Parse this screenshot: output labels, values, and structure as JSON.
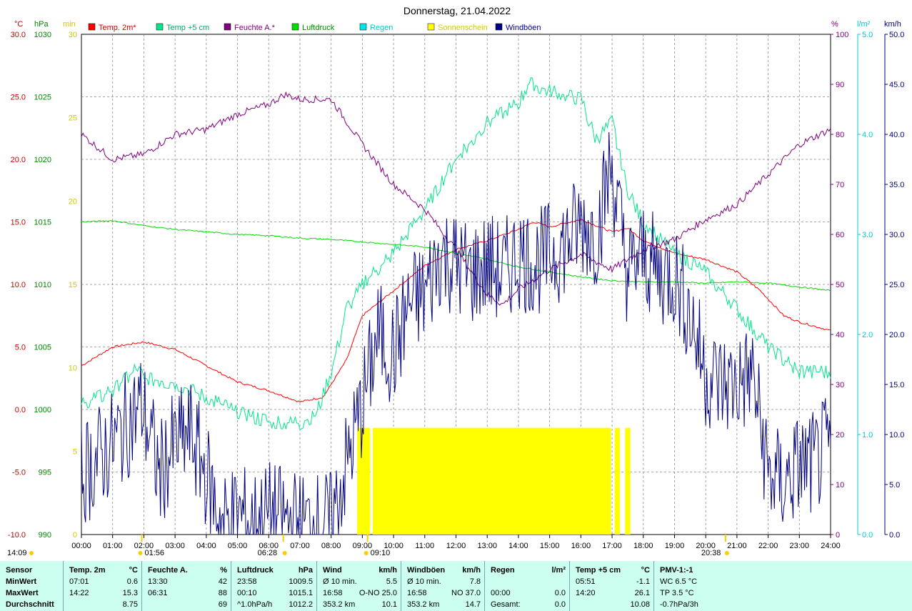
{
  "title": "Donnerstag, 21.04.2022",
  "colors": {
    "temp_2m": "#ff0000",
    "temp_5cm": "#00e68a",
    "feuchte": "#800080",
    "luftdruck": "#00dd00",
    "regen": "#00e5e5",
    "sonne": "#ffff00",
    "windboen": "#000080"
  },
  "axes": {
    "temp": {
      "unit": "°C",
      "ticks": [
        "30.0",
        "25.0",
        "20.0",
        "15.0",
        "10.0",
        "5.0",
        "0.0",
        "-5.0",
        "-10.0"
      ]
    },
    "pressure": {
      "unit": "hPa",
      "ticks": [
        "1030",
        "1025",
        "1020",
        "1015",
        "1010",
        "1005",
        "1000",
        "995",
        "990"
      ]
    },
    "minutes": {
      "unit": "min",
      "ticks": [
        "30",
        "25",
        "20",
        "15",
        "10",
        "5",
        "0"
      ]
    },
    "humidity": {
      "unit": "%",
      "ticks": [
        "100",
        "90",
        "80",
        "70",
        "60",
        "50",
        "40",
        "30",
        "20",
        "10",
        "0"
      ]
    },
    "rain": {
      "unit": "l/m²",
      "ticks": [
        "5.0",
        "4.0",
        "3.0",
        "2.0",
        "1.0",
        "0.0"
      ]
    },
    "wind": {
      "unit": "km/h",
      "ticks": [
        "50.0",
        "45.0",
        "40.0",
        "35.0",
        "30.0",
        "25.0",
        "20.0",
        "15.0",
        "10.0",
        "5.0",
        "0.0"
      ]
    },
    "x_ticks": [
      "00:00",
      "01:00",
      "02:00",
      "03:00",
      "04:00",
      "05:00",
      "06:00",
      "07:00",
      "08:00",
      "09:00",
      "10:00",
      "11:00",
      "12:00",
      "13:00",
      "14:00",
      "15:00",
      "16:00",
      "17:00",
      "18:00",
      "19:00",
      "20:00",
      "21:00",
      "22:00",
      "23:00",
      "24:00"
    ]
  },
  "legend": [
    "Temp. 2m*",
    "Temp +5 cm",
    "Feuchte A.*",
    "Luftdruck",
    "Regen",
    "Sonnenschein",
    "Windböen"
  ],
  "markers": {
    "moonrise": "14:09",
    "moonset": "01:56",
    "sunrise": "06:28",
    "sunrise_sun": "09:10",
    "sunset": "20:38"
  },
  "chart_data": {
    "type": "line",
    "x_range": [
      "00:00",
      "24:00"
    ],
    "series": [
      {
        "name": "Temp. 2m*",
        "unit": "°C",
        "points": [
          [
            "00:00",
            3.5
          ],
          [
            "01:00",
            5.0
          ],
          [
            "02:00",
            5.4
          ],
          [
            "03:00",
            4.8
          ],
          [
            "04:00",
            3.5
          ],
          [
            "05:00",
            2.2
          ],
          [
            "06:00",
            1.5
          ],
          [
            "07:00",
            0.6
          ],
          [
            "07:45",
            1.0
          ],
          [
            "08:30",
            4.0
          ],
          [
            "09:00",
            7.5
          ],
          [
            "10:00",
            9.5
          ],
          [
            "11:00",
            11.5
          ],
          [
            "12:00",
            12.8
          ],
          [
            "13:00",
            13.5
          ],
          [
            "14:00",
            14.4
          ],
          [
            "14:30",
            15.0
          ],
          [
            "15:00",
            14.6
          ],
          [
            "16:00",
            15.2
          ],
          [
            "17:00",
            14.2
          ],
          [
            "17:30",
            14.5
          ],
          [
            "18:00",
            13.5
          ],
          [
            "19:00",
            12.5
          ],
          [
            "20:00",
            12.0
          ],
          [
            "21:00",
            11.0
          ],
          [
            "21:45",
            9.5
          ],
          [
            "22:30",
            7.5
          ],
          [
            "23:00",
            7.0
          ],
          [
            "24:00",
            6.3
          ]
        ]
      },
      {
        "name": "Temp +5 cm",
        "unit": "°C",
        "points": [
          [
            "00:00",
            0.4
          ],
          [
            "01:00",
            1.5
          ],
          [
            "01:45",
            3.2
          ],
          [
            "02:00",
            2.5
          ],
          [
            "03:00",
            2.1
          ],
          [
            "04:00",
            1.0
          ],
          [
            "05:00",
            -0.2
          ],
          [
            "06:00",
            -1.0
          ],
          [
            "07:00",
            -1.1
          ],
          [
            "07:30",
            -0.5
          ],
          [
            "08:00",
            3.0
          ],
          [
            "08:30",
            8.0
          ],
          [
            "09:00",
            10.0
          ],
          [
            "10:00",
            12.5
          ],
          [
            "11:00",
            16.0
          ],
          [
            "12:00",
            20.0
          ],
          [
            "13:00",
            23.0
          ],
          [
            "14:00",
            24.5
          ],
          [
            "14:20",
            26.1
          ],
          [
            "15:00",
            25.5
          ],
          [
            "16:00",
            24.8
          ],
          [
            "16:30",
            21.5
          ],
          [
            "17:00",
            23.0
          ],
          [
            "17:30",
            17.5
          ],
          [
            "18:00",
            15.0
          ],
          [
            "19:00",
            12.5
          ],
          [
            "20:00",
            11.0
          ],
          [
            "21:00",
            8.0
          ],
          [
            "22:00",
            5.0
          ],
          [
            "23:00",
            3.0
          ],
          [
            "24:00",
            3.0
          ]
        ]
      },
      {
        "name": "Feuchte A.*",
        "unit": "%",
        "points": [
          [
            "00:00",
            80
          ],
          [
            "01:00",
            75
          ],
          [
            "02:00",
            76
          ],
          [
            "03:00",
            80
          ],
          [
            "04:00",
            81
          ],
          [
            "05:00",
            84
          ],
          [
            "06:00",
            86
          ],
          [
            "06:31",
            88
          ],
          [
            "07:00",
            87
          ],
          [
            "08:00",
            87
          ],
          [
            "09:00",
            78
          ],
          [
            "10:00",
            70
          ],
          [
            "11:00",
            65
          ],
          [
            "12:00",
            57
          ],
          [
            "13:00",
            48
          ],
          [
            "13:30",
            46
          ],
          [
            "14:00",
            49
          ],
          [
            "15:00",
            53
          ],
          [
            "16:00",
            56
          ],
          [
            "17:00",
            53
          ],
          [
            "18:00",
            57
          ],
          [
            "19:00",
            59
          ],
          [
            "20:00",
            63
          ],
          [
            "21:00",
            66
          ],
          [
            "22:00",
            72
          ],
          [
            "23:00",
            78
          ],
          [
            "24:00",
            81
          ]
        ]
      },
      {
        "name": "Luftdruck",
        "unit": "hPa",
        "points": [
          [
            "00:00",
            1015.0
          ],
          [
            "01:00",
            1015.1
          ],
          [
            "02:00",
            1014.7
          ],
          [
            "03:00",
            1014.4
          ],
          [
            "04:00",
            1014.2
          ],
          [
            "05:00",
            1014.0
          ],
          [
            "06:00",
            1013.9
          ],
          [
            "07:00",
            1013.7
          ],
          [
            "08:00",
            1013.6
          ],
          [
            "09:00",
            1013.4
          ],
          [
            "10:00",
            1013.2
          ],
          [
            "11:00",
            1013.0
          ],
          [
            "12:00",
            1012.5
          ],
          [
            "13:00",
            1012.0
          ],
          [
            "14:00",
            1011.4
          ],
          [
            "15:00",
            1011.0
          ],
          [
            "16:00",
            1010.6
          ],
          [
            "17:00",
            1010.3
          ],
          [
            "18:00",
            1010.2
          ],
          [
            "19:00",
            1010.2
          ],
          [
            "20:00",
            1010.1
          ],
          [
            "21:00",
            1010.2
          ],
          [
            "22:00",
            1010.1
          ],
          [
            "23:00",
            1009.8
          ],
          [
            "24:00",
            1009.5
          ]
        ]
      },
      {
        "name": "Windböen",
        "unit": "km/h",
        "points": [
          [
            "00:00",
            6
          ],
          [
            "01:00",
            9
          ],
          [
            "01:56",
            13
          ],
          [
            "02:30",
            6
          ],
          [
            "03:00",
            9
          ],
          [
            "03:30",
            10
          ],
          [
            "04:00",
            6
          ],
          [
            "04:30",
            1
          ],
          [
            "05:00",
            2
          ],
          [
            "05:30",
            1
          ],
          [
            "06:00",
            2
          ],
          [
            "07:00",
            1
          ],
          [
            "08:00",
            1
          ],
          [
            "08:30",
            7
          ],
          [
            "09:00",
            13
          ],
          [
            "09:30",
            20
          ],
          [
            "10:00",
            18
          ],
          [
            "10:30",
            23
          ],
          [
            "11:00",
            24
          ],
          [
            "11:30",
            28
          ],
          [
            "12:00",
            27
          ],
          [
            "12:30",
            26
          ],
          [
            "13:00",
            27
          ],
          [
            "13:30",
            26
          ],
          [
            "14:00",
            28
          ],
          [
            "14:30",
            27
          ],
          [
            "15:00",
            28
          ],
          [
            "15:30",
            29
          ],
          [
            "16:00",
            31
          ],
          [
            "16:30",
            30
          ],
          [
            "16:58",
            37
          ],
          [
            "17:30",
            26
          ],
          [
            "18:00",
            28
          ],
          [
            "18:30",
            26
          ],
          [
            "19:00",
            26
          ],
          [
            "19:30",
            22
          ],
          [
            "20:00",
            16
          ],
          [
            "20:30",
            15
          ],
          [
            "21:00",
            15
          ],
          [
            "21:30",
            16
          ],
          [
            "22:00",
            6
          ],
          [
            "22:30",
            5
          ],
          [
            "23:00",
            7
          ],
          [
            "23:30",
            7
          ],
          [
            "24:00",
            9
          ]
        ]
      }
    ],
    "sunshine_intervals": [
      [
        "08:50",
        "09:15"
      ],
      [
        "09:20",
        "16:58"
      ],
      [
        "17:05",
        "17:15"
      ],
      [
        "17:25",
        "17:35"
      ]
    ]
  },
  "stats": {
    "groups": [
      {
        "key": "sensor",
        "header": [
          "Sensor"
        ],
        "rows": [
          [
            "MinWert"
          ],
          [
            "MaxWert"
          ],
          [
            "Durchschnitt"
          ]
        ]
      },
      {
        "key": "temp2m",
        "header": [
          "Temp. 2m",
          "°C"
        ],
        "rows": [
          [
            "07:01",
            "0.6"
          ],
          [
            "14:22",
            "15.3"
          ],
          [
            "",
            "8.75"
          ]
        ]
      },
      {
        "key": "feuchte",
        "header": [
          "Feuchte A.",
          "%"
        ],
        "rows": [
          [
            "13:30",
            "42"
          ],
          [
            "06:31",
            "88"
          ],
          [
            "",
            "69"
          ]
        ]
      },
      {
        "key": "luftdruck",
        "header": [
          "Luftdruck",
          "hPa"
        ],
        "rows": [
          [
            "23:58",
            "1009.5"
          ],
          [
            "00:10",
            "1015.1"
          ],
          [
            "^1.0hPa/h",
            "1012.2"
          ]
        ]
      },
      {
        "key": "wind",
        "header": [
          "Wind",
          "km/h"
        ],
        "rows": [
          [
            "Ø 10 min.",
            "5.5"
          ],
          [
            "16:58",
            "O-NO 25.0"
          ],
          [
            "353.2 km",
            "10.1"
          ]
        ]
      },
      {
        "key": "windboen",
        "header": [
          "Windböen",
          "km/h"
        ],
        "rows": [
          [
            "Ø 10 min.",
            "7.8"
          ],
          [
            "16:58",
            "NO 37.0"
          ],
          [
            "353.2 km",
            "14.7"
          ]
        ]
      },
      {
        "key": "regen",
        "header": [
          "Regen",
          "l/m²"
        ],
        "rows": [
          [
            "",
            ""
          ],
          [
            "00:00",
            "0.0"
          ],
          [
            "Gesamt:",
            "0.0"
          ]
        ]
      },
      {
        "key": "temp5cm",
        "header": [
          "Temp +5 cm",
          "°C"
        ],
        "rows": [
          [
            "05:51",
            "-1.1"
          ],
          [
            "14:20",
            "26.1"
          ],
          [
            "",
            "10.08"
          ]
        ]
      },
      {
        "key": "pmv",
        "header": [
          "PMV-1:-1"
        ],
        "rows": [
          [
            "WC 6.5 °C"
          ],
          [
            "TP 3.5 °C"
          ],
          [
            "-0.7hPa/3h"
          ]
        ]
      }
    ]
  }
}
